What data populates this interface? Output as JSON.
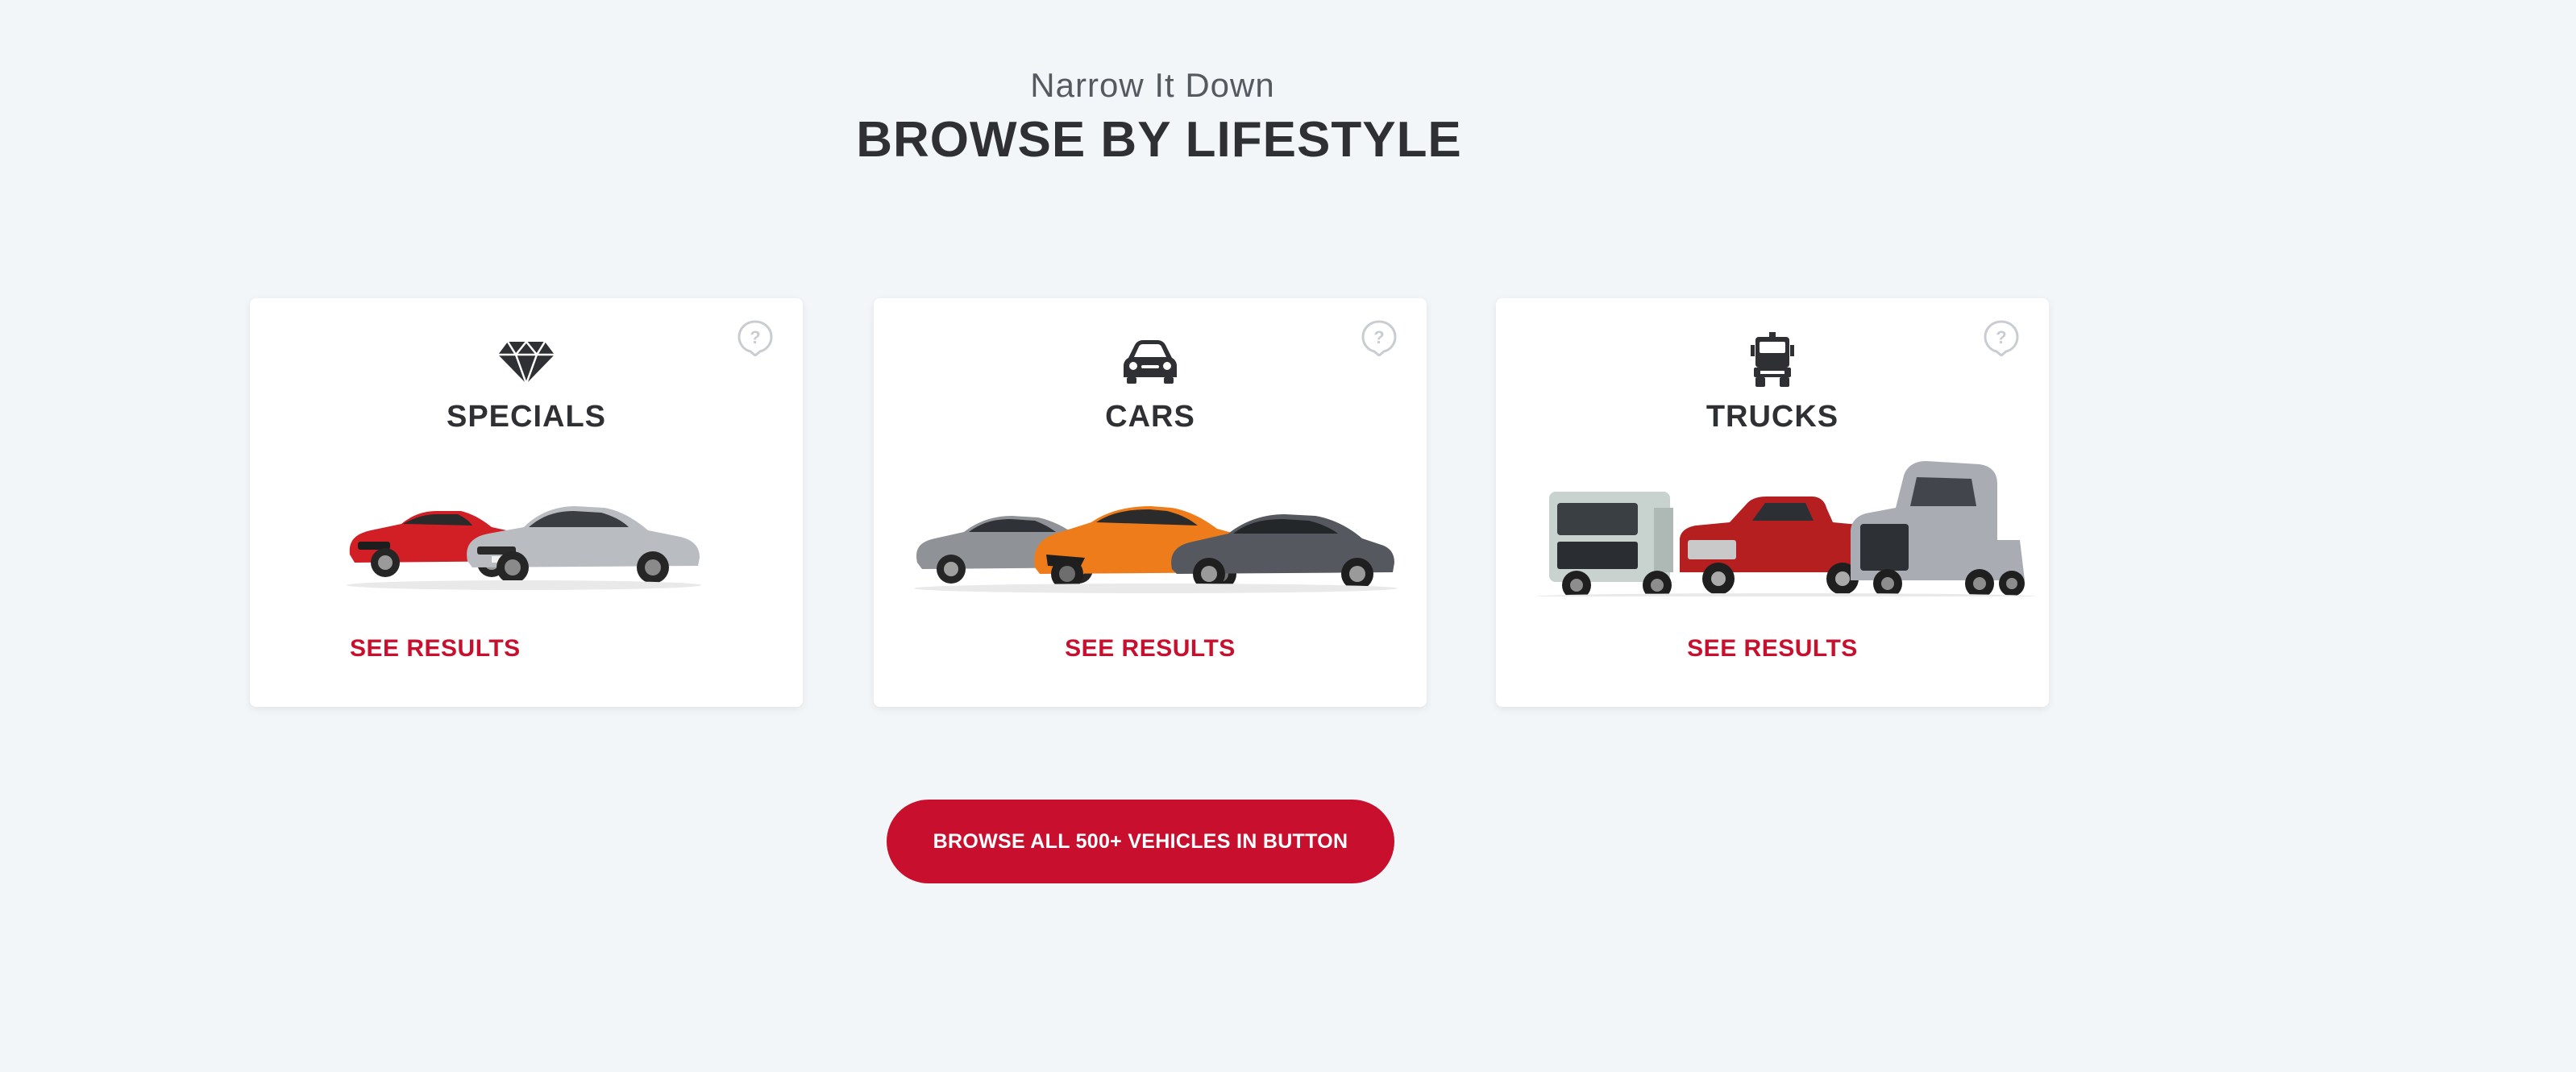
{
  "section": {
    "eyebrow": "Narrow It Down",
    "heading": "BROWSE BY LIFESTYLE"
  },
  "cards": [
    {
      "title": "SPECIALS",
      "icon": "diamond-icon",
      "link": "SEE RESULTS",
      "help_icon": "help-circle-icon"
    },
    {
      "title": "CARS",
      "icon": "car-icon",
      "link": "SEE RESULTS",
      "help_icon": "help-circle-icon"
    },
    {
      "title": "TRUCKS",
      "icon": "truck-icon",
      "link": "SEE RESULTS",
      "help_icon": "help-circle-icon"
    }
  ],
  "browse_button": {
    "label": "BROWSE ALL 500+ VEHICLES IN BUTTON"
  },
  "colors": {
    "accent": "#c8102e",
    "background": "#f3f6f9",
    "card": "#ffffff",
    "text": "#2f3033",
    "help_icon": "#c9ccd0"
  }
}
